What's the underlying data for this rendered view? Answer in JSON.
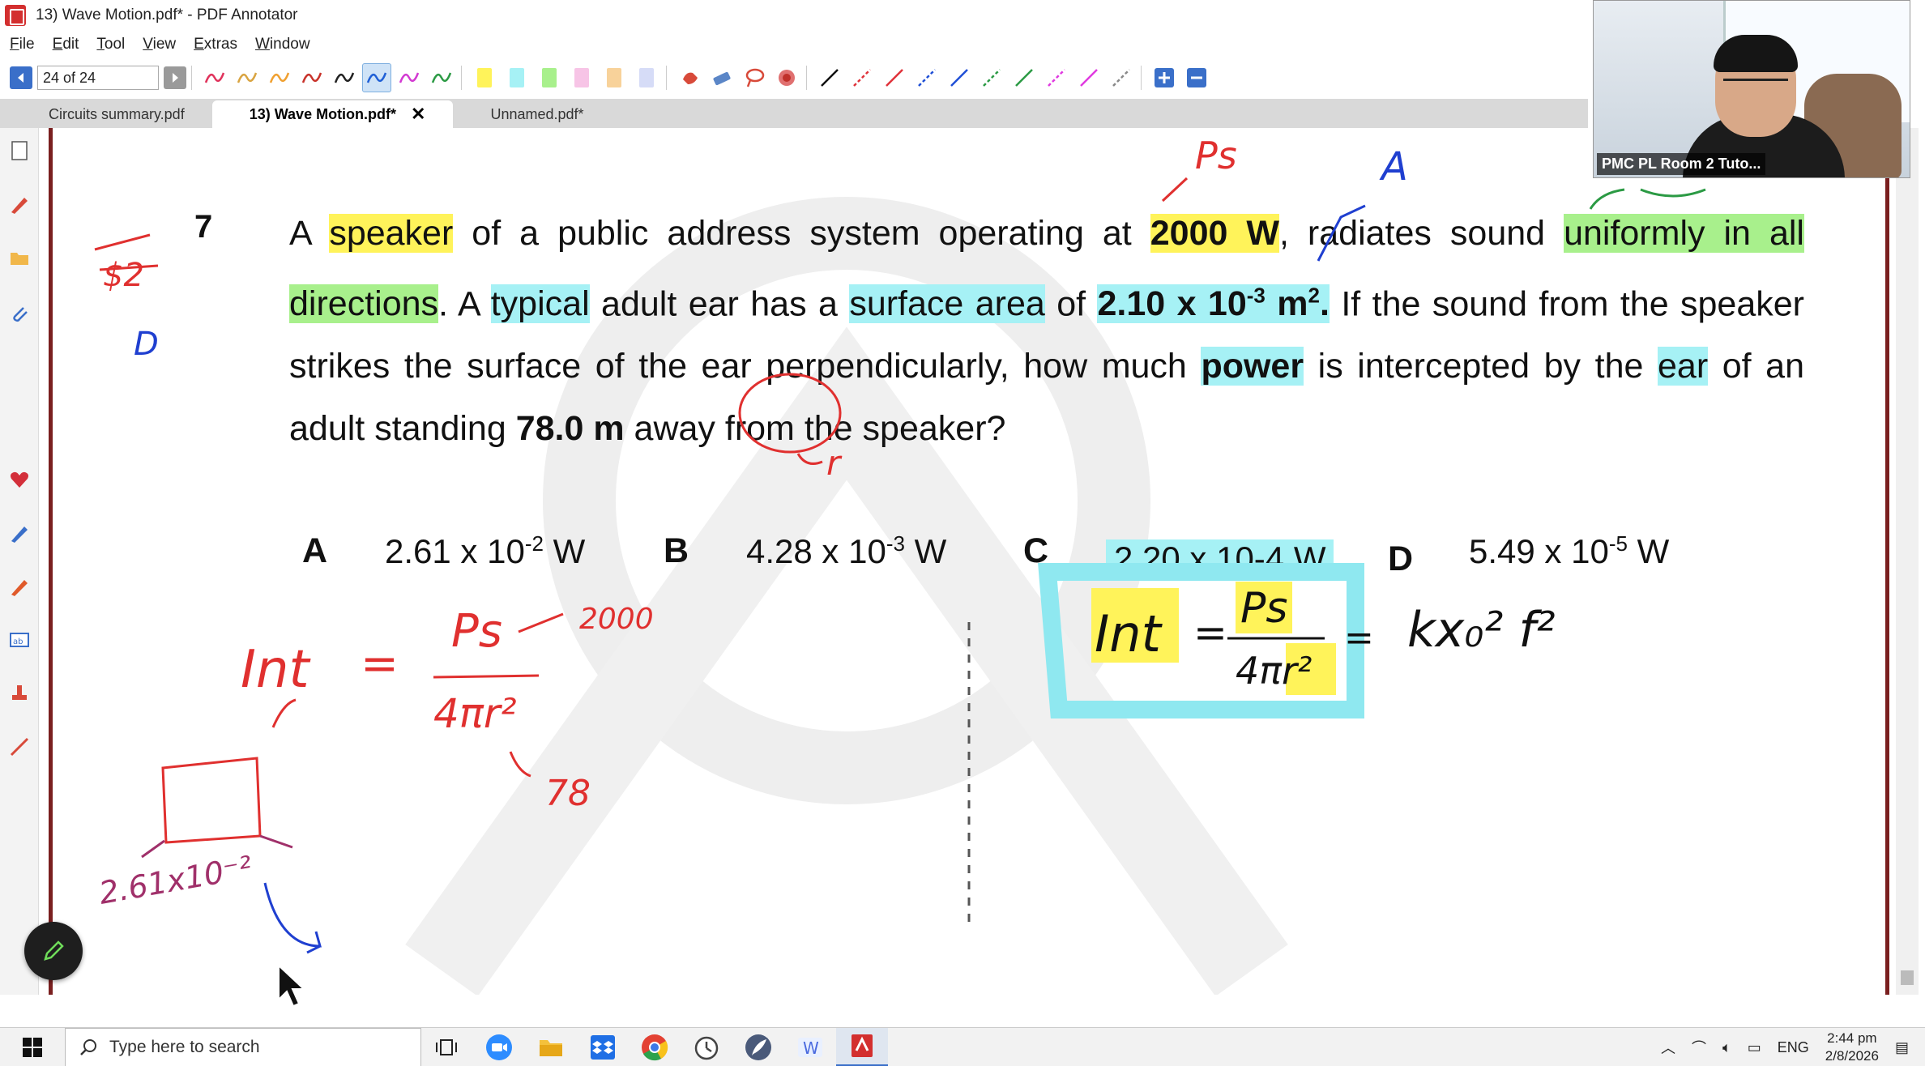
{
  "window": {
    "title": "13) Wave Motion.pdf* - PDF Annotator"
  },
  "menu": [
    {
      "label": "File",
      "key": "F",
      "rest": "ile"
    },
    {
      "label": "Edit",
      "key": "E",
      "rest": "dit"
    },
    {
      "label": "Tool",
      "key": "T",
      "rest": "ool"
    },
    {
      "label": "View",
      "key": "V",
      "rest": "iew"
    },
    {
      "label": "Extras",
      "key": "E",
      "rest": "xtras"
    },
    {
      "label": "Window",
      "key": "W",
      "rest": "indow"
    }
  ],
  "toolbar": {
    "page_indicator": "24 of 24",
    "current_page": 24,
    "total_pages": 24,
    "pen_colors": [
      "#e0325b",
      "#d9a441",
      "#f0a030",
      "#c8322a",
      "#222222",
      "#1f5fd6",
      "#d33ad2",
      "#2b9a44"
    ],
    "highlighter_colors": [
      "#fff35a",
      "#a6f1f5",
      "#a8f08c",
      "#f7c4e6",
      "#f8d29a",
      "#d6dcf7"
    ],
    "line_colors": [
      "#111111",
      "#e0323a",
      "#e0323a",
      "#1f4fd6",
      "#1f4fd6",
      "#2b9a44",
      "#2b9a44",
      "#e03ae0",
      "#e03ae0",
      "#888888"
    ]
  },
  "tabs": [
    {
      "label": "Circuits summary.pdf",
      "active": false
    },
    {
      "label": "13)  Wave Motion.pdf*",
      "active": true
    },
    {
      "label": "Unnamed.pdf*",
      "active": false
    }
  ],
  "question": {
    "number": "7",
    "segments": {
      "s1": "A ",
      "s2": "speaker",
      "s3": " of a public address system operating at ",
      "s4": "2000 W",
      "s5": ", radiates sound ",
      "s6": "uniformly in all directions",
      "s7": ". A ",
      "s8": "typical",
      "s9": " adult ear has a ",
      "s10": "surface area",
      "s11": " of ",
      "s12": "2.10 x 10",
      "s12sup": "-3",
      "s13": " m",
      "s13sup": "2",
      "s14": ".",
      "s15": " If the sound from the speaker strikes the surface of the ear perpendicularly, how much ",
      "s16": "power",
      "s17": " is intercepted by the ",
      "s18": "ear",
      "s19": " of an adult standing ",
      "s20": "78.0 m",
      "s21": " away from the speaker?"
    }
  },
  "choices": [
    {
      "letter": "A",
      "base": "2.61 x 10",
      "exp": "-2",
      "unit": " W"
    },
    {
      "letter": "B",
      "base": "4.28 x 10",
      "exp": "-3",
      "unit": " W"
    },
    {
      "letter": "C",
      "base": "2.20 x 10-4 W",
      "exp": "",
      "unit": ""
    },
    {
      "letter": "D",
      "base": "5.49 x 10",
      "exp": "-5",
      "unit": " W"
    }
  ],
  "handwriting": {
    "left_margin_1": "$2",
    "left_margin_2": "D",
    "ps_label": "Ps",
    "a_label": "A",
    "r_label": "r",
    "int_label": "Int",
    "equals": "=",
    "numerator": "Ps",
    "denominator": "4πr²",
    "value_2000": "2000",
    "value_78": "78",
    "value_261": "2.61x10⁻²",
    "formula_right_lhs": "Int",
    "formula_right_num": "Ps",
    "formula_right_den": "4πr²",
    "formula_right_rhs": "kx₀² f²"
  },
  "webcam": {
    "label": "PMC PL Room 2 Tuto..."
  },
  "taskbar": {
    "search_placeholder": "Type here to search",
    "language": "ENG",
    "time": "2:44 pm",
    "date": "2/8/2026"
  },
  "colors": {
    "highlight_yellow": "#fff35a",
    "highlight_cyan": "#a6f1f5",
    "highlight_green": "#a8f08c",
    "ink_red": "#e0302f",
    "ink_blue": "#1f3fd0",
    "ink_purple": "#a0306a",
    "ink_black": "#111111",
    "ink_green": "#2b9a44",
    "accent": "#3a6fc9"
  }
}
